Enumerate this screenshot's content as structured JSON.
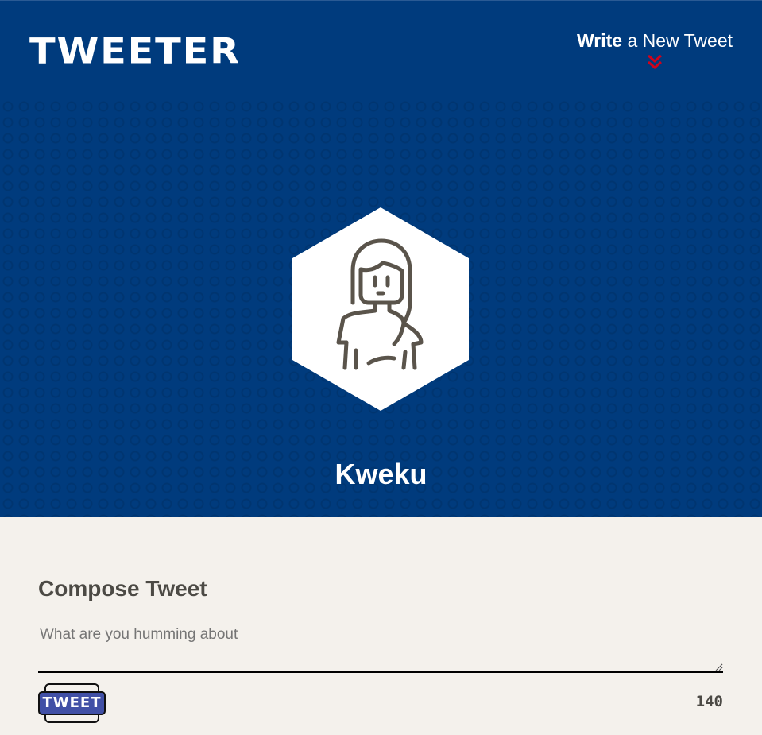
{
  "nav": {
    "logo": "TWEETER",
    "write_link_bold": "Write",
    "write_link_rest": " a New Tweet",
    "chevron_icon": "double-chevron-down-icon",
    "colors": {
      "background": "#003b7d",
      "chevron": "#d0021b"
    }
  },
  "profile": {
    "avatar_icon": "woman-avatar-icon",
    "name": "Kweku"
  },
  "compose": {
    "title": "Compose Tweet",
    "placeholder": "What are you humming about",
    "value": "",
    "submit_label": "TWEET",
    "char_counter": "140",
    "colors": {
      "background": "#f4f1ec",
      "button": "#4150a6"
    }
  }
}
